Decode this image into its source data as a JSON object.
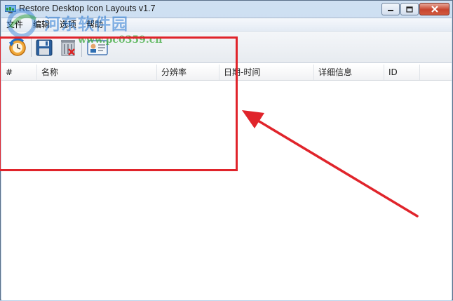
{
  "window": {
    "title": "Restore Desktop Icon Layouts v1.7"
  },
  "menu": [
    {
      "label": "文件"
    },
    {
      "label": "编辑"
    },
    {
      "label": "选项"
    },
    {
      "label": "帮助"
    }
  ],
  "toolbar": {
    "buttons": [
      {
        "icon": "restore-icon"
      },
      {
        "icon": "save-icon"
      },
      {
        "icon": "delete-icon"
      },
      {
        "icon": "info-card-icon"
      }
    ]
  },
  "table": {
    "columns": [
      "#",
      "名称",
      "分辨率",
      "日期-时间",
      "详细信息",
      "ID"
    ],
    "rows": []
  },
  "watermark": {
    "text": "河东软件园",
    "url": "www.pc0359.cn"
  },
  "annotation": {
    "color": "#e0242b"
  }
}
